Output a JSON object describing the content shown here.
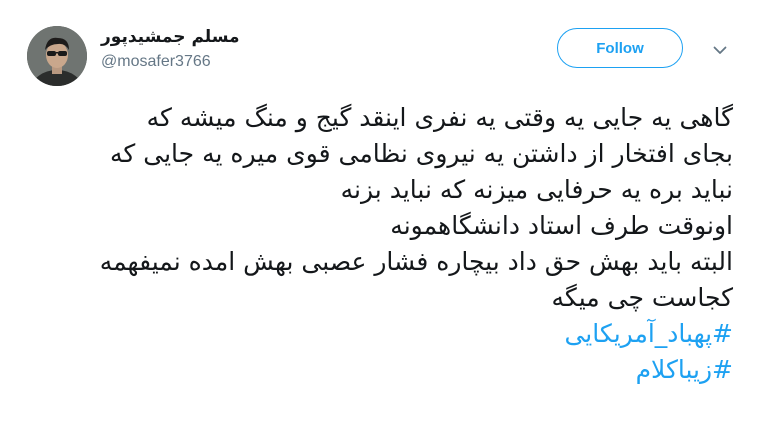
{
  "author": {
    "display_name": "مسلم جمشیدپور",
    "handle": "@mosafer3766",
    "avatar_icon": "user-avatar-photo"
  },
  "actions": {
    "follow_label": "Follow",
    "menu_icon": "chevron-down-icon"
  },
  "tweet": {
    "lines": [
      "گاهی یه جایی یه وقتی یه نفری اینقد گیج و منگ میشه که",
      "بجای افتخار از داشتن یه نیروی نظامی قوی میره یه جایی که",
      "نباید بره یه حرفایی میزنه که  نباید بزنه",
      "اونوقت طرف استاد دانشگاهمونه",
      "البته باید بهش حق داد بیچاره فشار عصبی بهش امده نمیفهمه",
      "کجاست چی میگه"
    ],
    "hashtags": [
      "#پهباد_آمریکایی",
      "#زیباکلام"
    ]
  },
  "colors": {
    "accent": "#1da1f2",
    "text": "#14171a",
    "muted": "#657786"
  }
}
